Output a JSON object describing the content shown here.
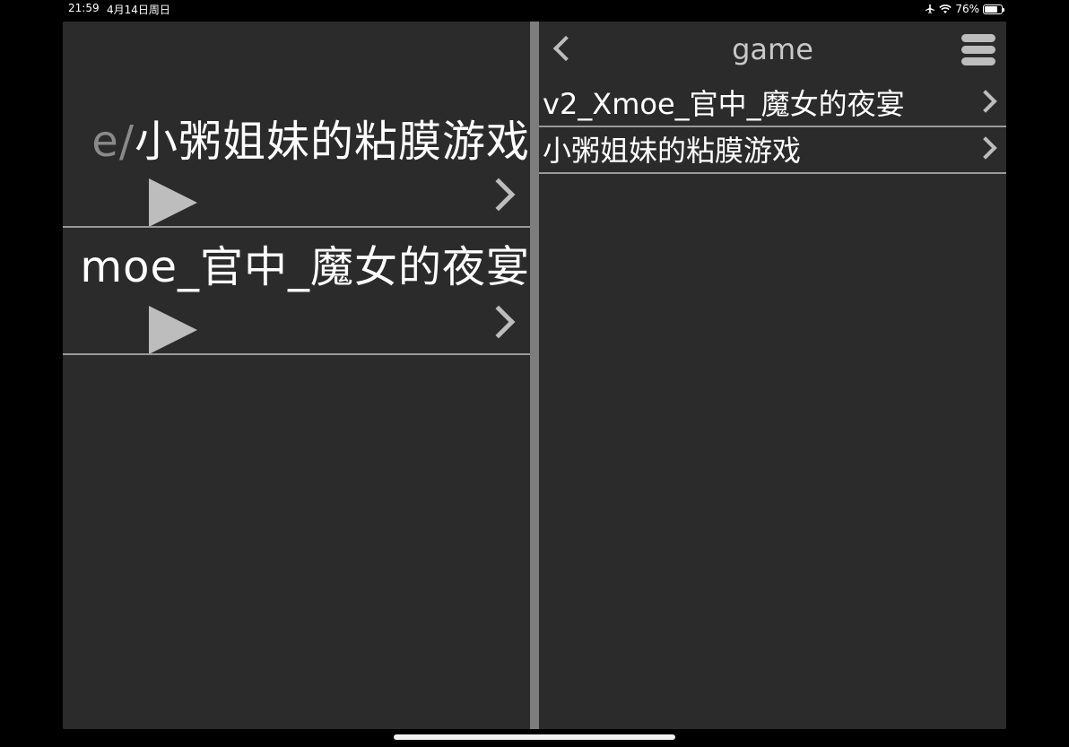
{
  "status_bar": {
    "time": "21:59",
    "date": "4月14日周日",
    "battery_percent": "76%",
    "battery_level": 0.76,
    "icons": [
      "airplane-icon",
      "wifi-icon",
      "battery-icon"
    ]
  },
  "left_pane": {
    "rows": [
      {
        "prefix": "e/",
        "title": "小粥姐妹的粘膜游戏"
      },
      {
        "prefix": "",
        "title": "moe_官中_魔女的夜宴"
      }
    ]
  },
  "right_pane": {
    "nav_title": "game",
    "items": [
      {
        "label": "v2_Xmoe_官中_魔女的夜宴"
      },
      {
        "label": "小粥姐妹的粘膜游戏"
      }
    ]
  },
  "colors": {
    "background": "#000000",
    "panel": "#2b2b2b",
    "divider": "#7d7d7d",
    "accent_gray": "#bdbdbd"
  }
}
